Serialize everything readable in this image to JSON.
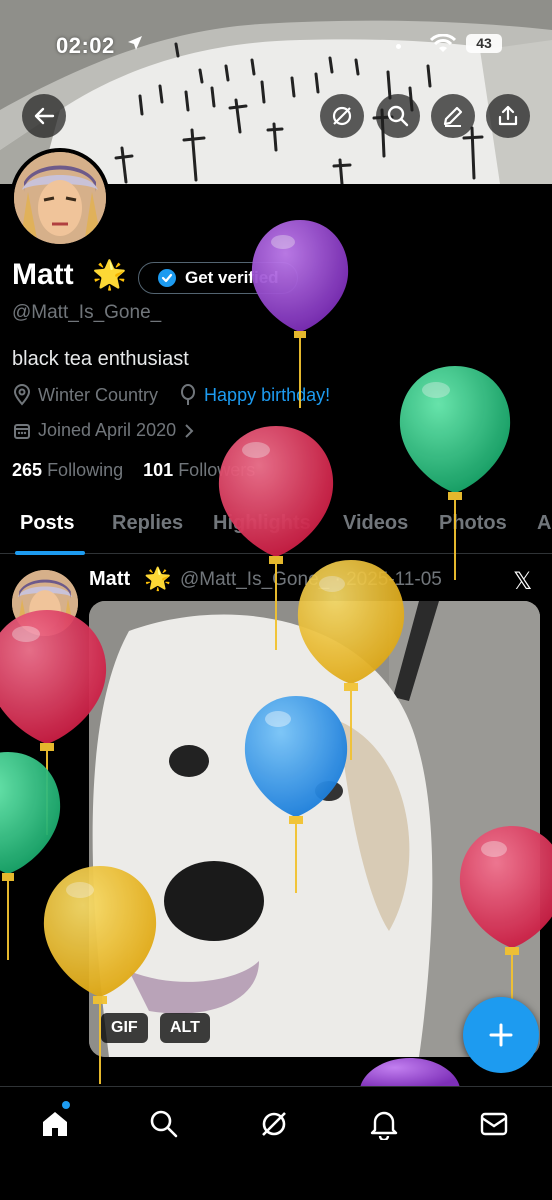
{
  "status_bar": {
    "time": "02:02",
    "battery": "43"
  },
  "profile": {
    "display_name": "Matt",
    "name_emoji": "🌟",
    "get_verified_label": "Get verified",
    "handle": "@Matt_Is_Gone_",
    "bio": "black tea enthusiast",
    "location": "Winter Country",
    "birthday_link": "Happy birthday!",
    "joined": "Joined April 2020",
    "following_count": "265",
    "following_label": "Following",
    "followers_count": "101",
    "followers_label": "Followers"
  },
  "tabs": [
    {
      "label": "Posts",
      "active": true
    },
    {
      "label": "Replies"
    },
    {
      "label": "Highlights"
    },
    {
      "label": "Videos"
    },
    {
      "label": "Photos"
    },
    {
      "label": "A"
    }
  ],
  "post": {
    "author": "Matt",
    "author_emoji": "🌟",
    "handle_date": "@Matt_Is_Gone_ · 2025-11-05",
    "platform_mark": "𝕏",
    "media_tags": [
      "GIF",
      "ALT"
    ]
  },
  "icons": {
    "top": [
      "back-arrow-icon",
      "grok-icon",
      "search-icon",
      "edit-icon",
      "share-icon"
    ],
    "nav": [
      "home-icon",
      "search-icon",
      "grok-icon",
      "notifications-icon",
      "messages-icon"
    ],
    "fab": "plus-icon"
  },
  "colors": {
    "accent": "#1d9bf0",
    "balloon_purple": "#9b3fd4",
    "balloon_green": "#2ecf8a",
    "balloon_red": "#e8365a",
    "balloon_yellow": "#f2c230",
    "balloon_blue": "#2f9bf0"
  }
}
